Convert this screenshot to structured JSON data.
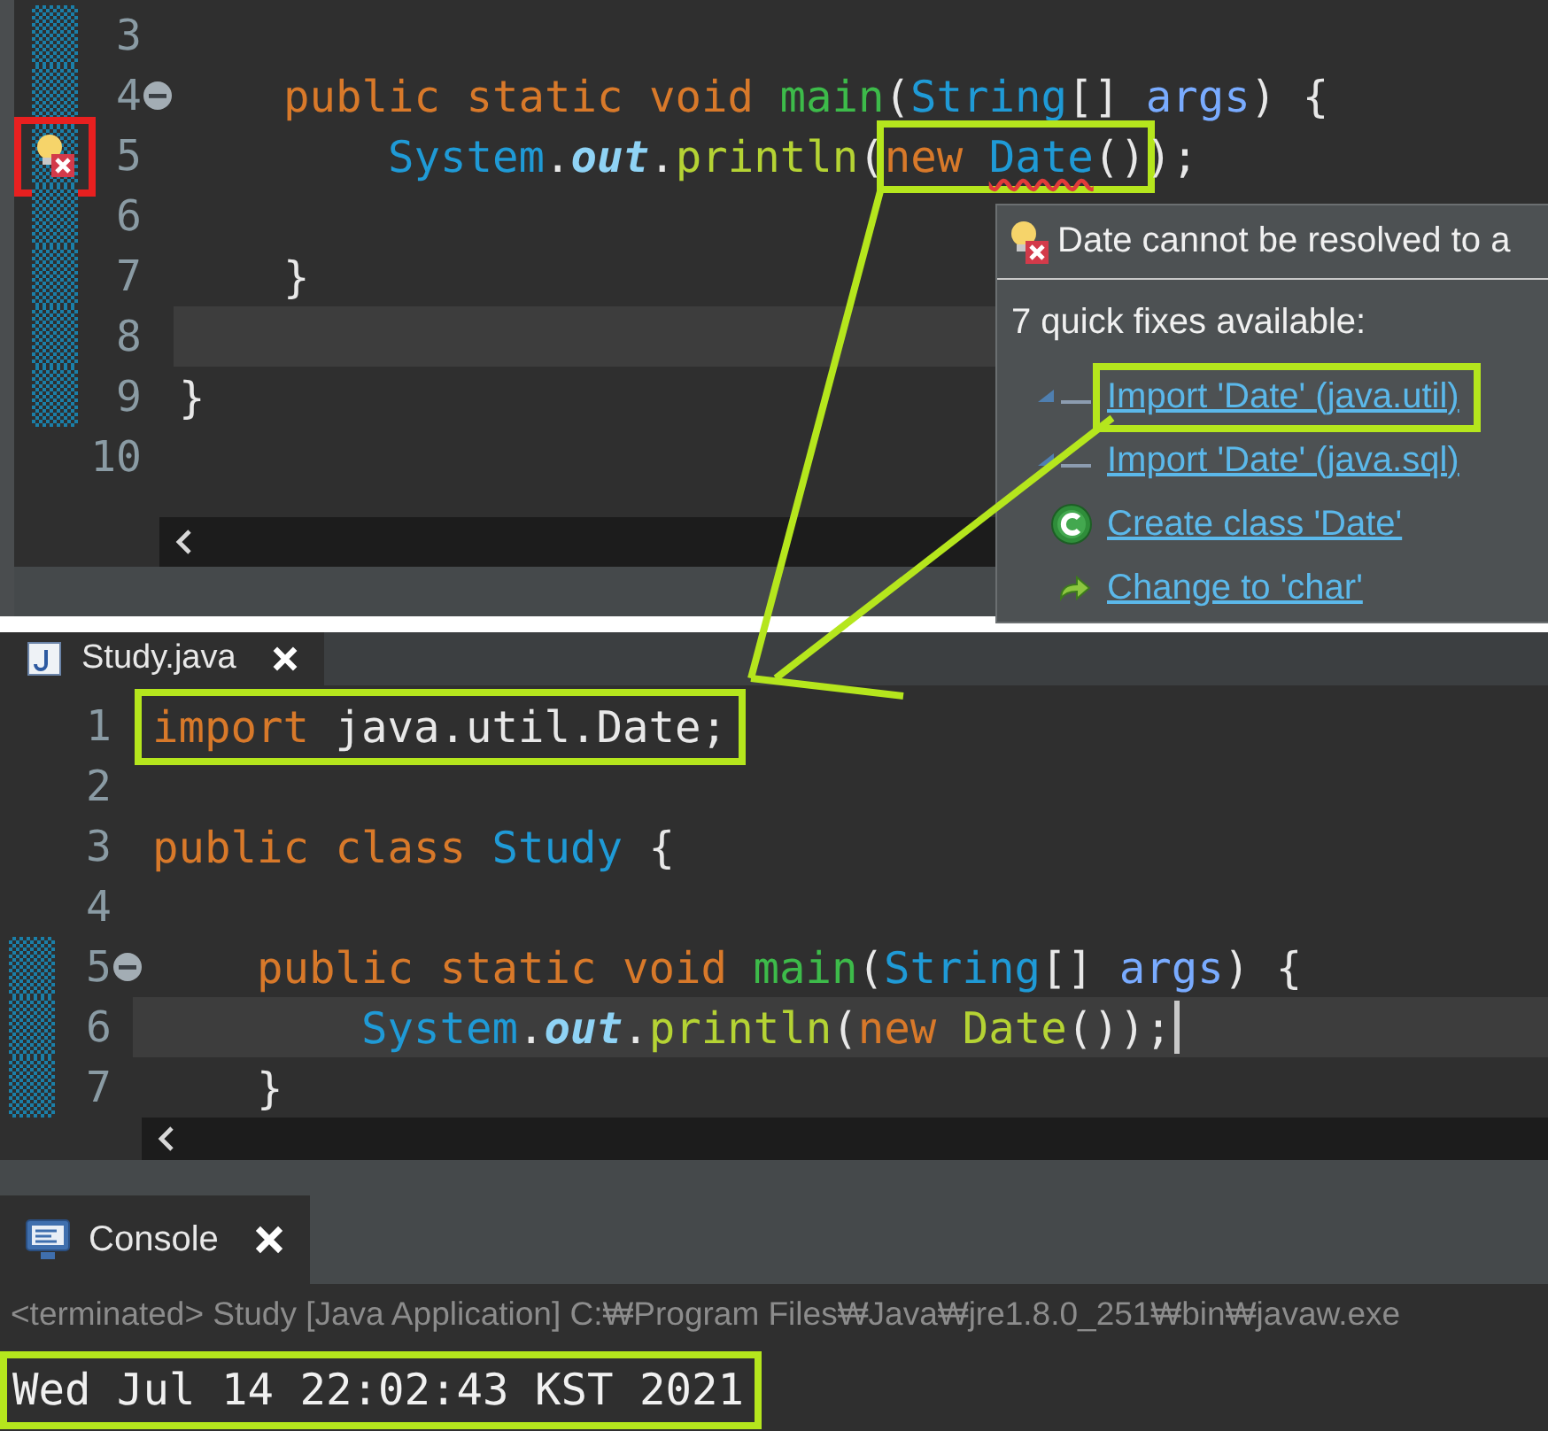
{
  "top_editor": {
    "lines": [
      {
        "number": "3",
        "current": false,
        "changed": true,
        "fold": false,
        "error": false,
        "marker_framed": false
      },
      {
        "number": "4",
        "current": false,
        "changed": true,
        "fold": true,
        "error": false,
        "marker_framed": false,
        "tokens": [
          {
            "kind": "keyword",
            "text": "    public static void ",
            "framed": false
          },
          {
            "kind": "method_decl",
            "text": "main",
            "framed": false
          },
          {
            "kind": "plain",
            "text": "(",
            "framed": false
          },
          {
            "kind": "type",
            "text": "String",
            "framed": false
          },
          {
            "kind": "plain",
            "text": "[] ",
            "framed": false
          },
          {
            "kind": "param",
            "text": "args",
            "framed": false
          },
          {
            "kind": "plain",
            "text": ") {",
            "framed": false
          }
        ]
      },
      {
        "number": "5",
        "current": false,
        "changed": true,
        "fold": false,
        "error": true,
        "marker_framed": true,
        "tokens": [
          {
            "kind": "type",
            "text": "        System",
            "framed": false
          },
          {
            "kind": "plain",
            "text": ".",
            "framed": false
          },
          {
            "kind": "field",
            "text": "out",
            "framed": false
          },
          {
            "kind": "plain",
            "text": ".",
            "framed": false
          },
          {
            "kind": "method",
            "text": "println",
            "framed": false
          },
          {
            "kind": "plain",
            "text": "(",
            "framed": false
          },
          {
            "kind": "keyword",
            "text": "new ",
            "framed": true
          },
          {
            "kind": "error",
            "text": "Date",
            "framed": true
          },
          {
            "kind": "plain",
            "text": "()",
            "framed": true
          },
          {
            "kind": "plain",
            "text": ");",
            "framed": false
          }
        ]
      },
      {
        "number": "6",
        "current": false,
        "changed": true,
        "fold": false,
        "error": false,
        "marker_framed": false
      },
      {
        "number": "7",
        "current": false,
        "changed": true,
        "fold": false,
        "error": false,
        "marker_framed": false,
        "tokens": [
          {
            "kind": "plain",
            "text": "    }",
            "framed": false
          }
        ]
      },
      {
        "number": "8",
        "current": true,
        "changed": true,
        "fold": false,
        "error": false,
        "marker_framed": false
      },
      {
        "number": "9",
        "current": false,
        "changed": true,
        "fold": false,
        "error": false,
        "marker_framed": false,
        "tokens": [
          {
            "kind": "plain",
            "text": "}",
            "framed": false
          }
        ]
      },
      {
        "number": "10",
        "current": false,
        "changed": false,
        "fold": false,
        "error": false,
        "marker_framed": false
      }
    ]
  },
  "quick_fix_popup": {
    "title": "Date cannot be resolved to a",
    "subtitle": "7 quick fixes available:",
    "fixes": [
      {
        "label": "Import 'Date' (java.util)",
        "kind": "import",
        "framed": true
      },
      {
        "label": "Import 'Date' (java.sql)",
        "kind": "import",
        "framed": false
      },
      {
        "label": "Create class 'Date'",
        "kind": "class",
        "framed": false
      },
      {
        "label": "Change to 'char'",
        "kind": "change",
        "framed": false
      }
    ]
  },
  "bottom_editor": {
    "tab": {
      "label": "Study.java"
    },
    "lines": [
      {
        "number": "1",
        "current": false,
        "changed": false,
        "fold": false,
        "caret": false,
        "framed": true,
        "tokens": [
          {
            "kind": "keyword",
            "text": "import"
          },
          {
            "kind": "plain",
            "text": " java.util.Date;"
          }
        ]
      },
      {
        "number": "2",
        "current": false,
        "changed": false,
        "fold": false,
        "caret": false,
        "framed": false
      },
      {
        "number": "3",
        "current": false,
        "changed": false,
        "fold": false,
        "caret": false,
        "framed": false,
        "tokens": [
          {
            "kind": "keyword",
            "text": "public class "
          },
          {
            "kind": "type",
            "text": "Study"
          },
          {
            "kind": "plain",
            "text": " {"
          }
        ]
      },
      {
        "number": "4",
        "current": false,
        "changed": false,
        "fold": false,
        "caret": false,
        "framed": false
      },
      {
        "number": "5",
        "current": false,
        "changed": true,
        "fold": true,
        "caret": false,
        "framed": false,
        "tokens": [
          {
            "kind": "keyword",
            "text": "    public static void "
          },
          {
            "kind": "method_decl",
            "text": "main"
          },
          {
            "kind": "plain",
            "text": "("
          },
          {
            "kind": "type",
            "text": "String"
          },
          {
            "kind": "plain",
            "text": "[] "
          },
          {
            "kind": "param",
            "text": "args"
          },
          {
            "kind": "plain",
            "text": ") {"
          }
        ]
      },
      {
        "number": "6",
        "current": true,
        "changed": true,
        "fold": false,
        "caret": true,
        "framed": false,
        "tokens": [
          {
            "kind": "type",
            "text": "        System"
          },
          {
            "kind": "plain",
            "text": "."
          },
          {
            "kind": "field",
            "text": "out"
          },
          {
            "kind": "plain",
            "text": "."
          },
          {
            "kind": "method",
            "text": "println"
          },
          {
            "kind": "plain",
            "text": "("
          },
          {
            "kind": "keyword",
            "text": "new "
          },
          {
            "kind": "class",
            "text": "Date"
          },
          {
            "kind": "plain",
            "text": "());"
          }
        ]
      },
      {
        "number": "7",
        "current": false,
        "changed": true,
        "fold": false,
        "caret": false,
        "framed": false,
        "tokens": [
          {
            "kind": "plain",
            "text": "    }"
          }
        ]
      }
    ]
  },
  "console": {
    "tab": {
      "label": "Console"
    },
    "header": "<terminated> Study [Java Application] C:₩Program Files₩Java₩jre1.8.0_251₩bin₩javaw.exe",
    "output": {
      "text": "Wed Jul 14 22:02:43 KST 2021",
      "framed": true
    }
  }
}
